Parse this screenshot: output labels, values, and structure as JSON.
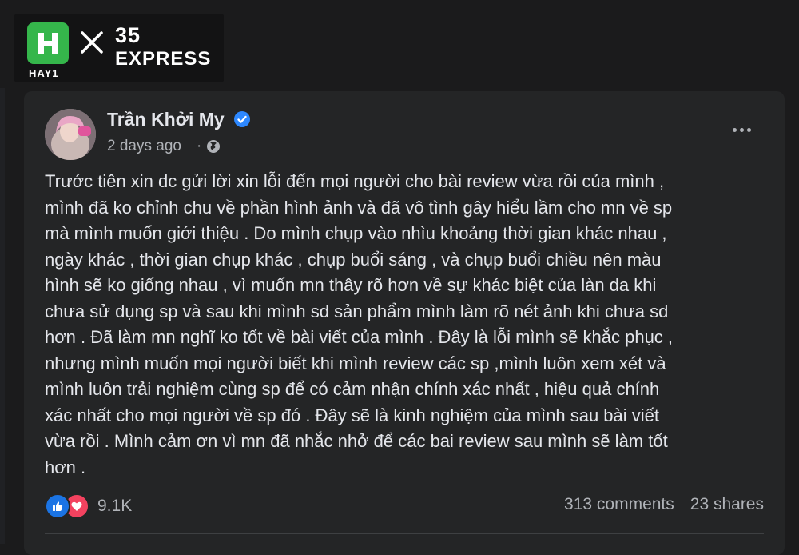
{
  "brand": {
    "left_logo_label": "HAY1",
    "partner_top": "35",
    "partner_bottom": "EXPRESS"
  },
  "post": {
    "author": "Trần Khởi My",
    "time": "2 days ago",
    "privacy_icon": "globe-icon",
    "verified_icon": "verified-badge-icon",
    "text": "Trước tiên xin dc gửi lời xin lỗi đến mọi người cho bài review vừa rồi của mình ,\nmình đã ko chỉnh chu về phần hình ảnh và đã vô tình gây hiểu lầm cho mn về sp\nmà mình muốn giới thiệu . Do mình chụp vào nhìu khoảng thời gian khác nhau ,\nngày khác , thời gian chụp khác , chụp buổi sáng , và chụp buổi chiều nên màu\nhình sẽ ko giống nhau ,  vì muốn mn thây rõ hơn về sự khác biệt của làn da  khi\nchưa sử dụng sp và sau khi mình sd sản phẩm mình làm rõ nét ảnh khi chưa sd\nhơn . Đã làm mn nghĩ ko tốt về bài viết của mình . Đây là lỗi mình sẽ khắc phục ,\nnhưng mình muốn mọi người biết khi mình review các sp ,mình luôn xem xét và\nmình luôn trải nghiệm cùng sp để có cảm nhận chính xác nhất , hiệu quả chính\nxác nhất  cho mọi người về sp đó . Đây sẽ là kinh nghiệm của mình sau bài viết\nvừa rồi . Mình cảm ơn vì mn đã nhắc nhở để các bai review sau mình sẽ làm tốt\nhơn .",
    "reactions_count": "9.1K",
    "comments": "313 comments",
    "shares": "23 shares"
  },
  "colors": {
    "background": "#1b1b1c",
    "card": "#242526",
    "brand_green": "#35b64b",
    "like_blue": "#1b74e4",
    "love_red": "#f3425f",
    "verified_blue": "#2d88ff"
  }
}
